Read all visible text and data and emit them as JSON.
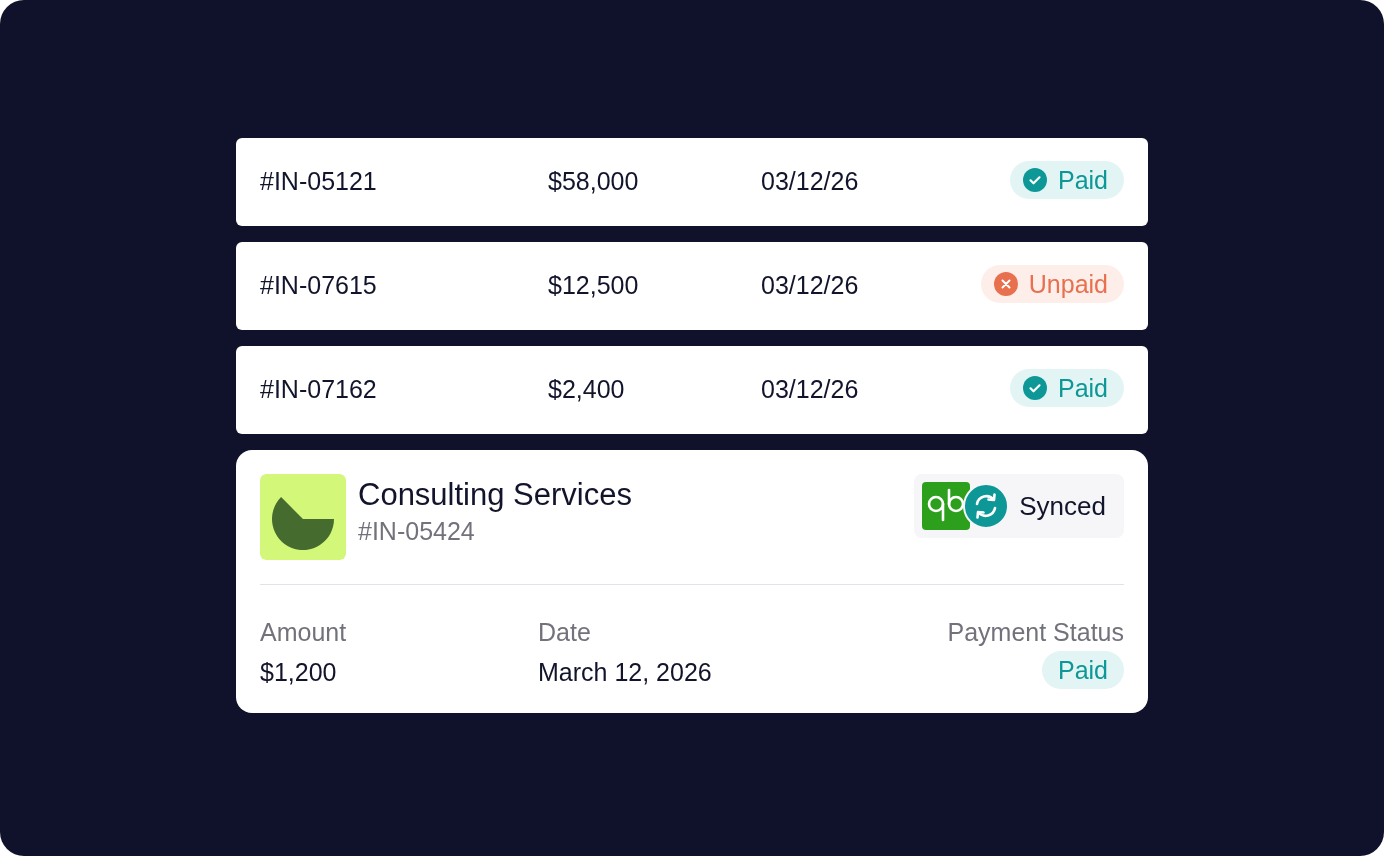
{
  "invoices": [
    {
      "number": "#IN-05121",
      "amount": "$58,000",
      "date": "03/12/26",
      "status": {
        "kind": "paid",
        "label": "Paid"
      }
    },
    {
      "number": "#IN-07615",
      "amount": "$12,500",
      "date": "03/12/26",
      "status": {
        "kind": "unpaid",
        "label": "Unpaid"
      }
    },
    {
      "number": "#IN-07162",
      "amount": "$2,400",
      "date": "03/12/26",
      "status": {
        "kind": "paid",
        "label": "Paid"
      }
    }
  ],
  "detail": {
    "title": "Consulting Services",
    "number": "#IN-05424",
    "sync_label": "Synced",
    "amount": {
      "label": "Amount",
      "value": "$1,200"
    },
    "date": {
      "label": "Date",
      "value": "March 12, 2026"
    },
    "payment_status": {
      "label": "Payment Status",
      "value": "Paid",
      "kind": "paid"
    }
  }
}
